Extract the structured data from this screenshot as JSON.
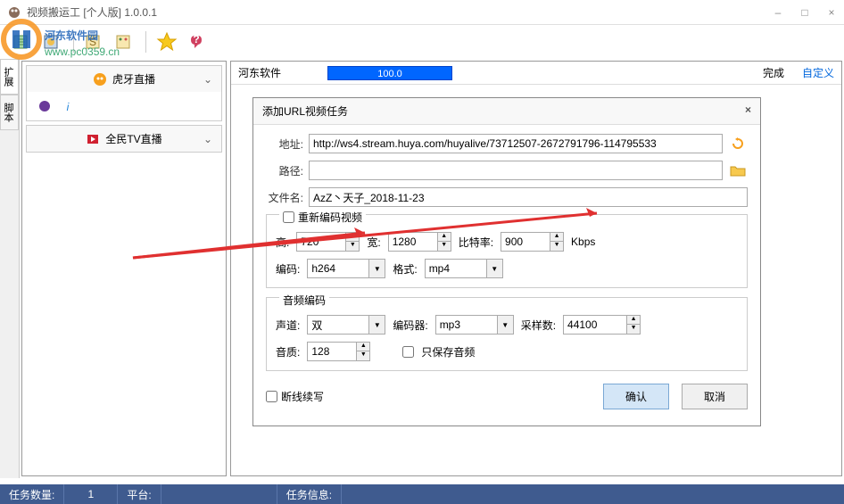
{
  "window": {
    "title": "视频搬运工 [个人版] 1.0.0.1",
    "min_icon": "–",
    "max_icon": "□",
    "close_icon": "×"
  },
  "sidebar": {
    "tabs": [
      "扩展",
      "脚本"
    ],
    "items": [
      {
        "label": "虎牙直播"
      },
      {
        "label": "全民TV直播"
      }
    ]
  },
  "content": {
    "title": "河东软件",
    "progress": "100.0",
    "status": "完成",
    "custom": "自定义"
  },
  "dialog": {
    "title": "添加URL视频任务",
    "close": "×",
    "url_label": "地址:",
    "url_value": "http://ws4.stream.huya.com/huyalive/73712507-2672791796-114795533",
    "path_label": "路径:",
    "path_value": "",
    "filename_label": "文件名:",
    "filename_value": "AzZ丶天子_2018-11-23",
    "reenc_label": "重新编码视频",
    "height_label": "高:",
    "height_value": "720",
    "width_label": "宽:",
    "width_value": "1280",
    "bitrate_label": "比特率:",
    "bitrate_value": "900",
    "kbps": "Kbps",
    "codec_label": "编码:",
    "codec_value": "h264",
    "format_label": "格式:",
    "format_value": "mp4",
    "audio_legend": "音频编码",
    "channels_label": "声道:",
    "channels_value": "双",
    "encoder_label": "编码器:",
    "encoder_value": "mp3",
    "sample_label": "采样数:",
    "sample_value": "44100",
    "quality_label": "音质:",
    "quality_value": "128",
    "audio_only_label": "只保存音频",
    "resume_label": "断线续写",
    "ok": "确认",
    "cancel": "取消"
  },
  "statusbar": {
    "task_count_label": "任务数量:",
    "task_count": "1",
    "platform_label": "平台:",
    "task_info_label": "任务信息:"
  },
  "watermark": {
    "text1": "河东软件园",
    "text2": "www.pc0359.cn"
  }
}
